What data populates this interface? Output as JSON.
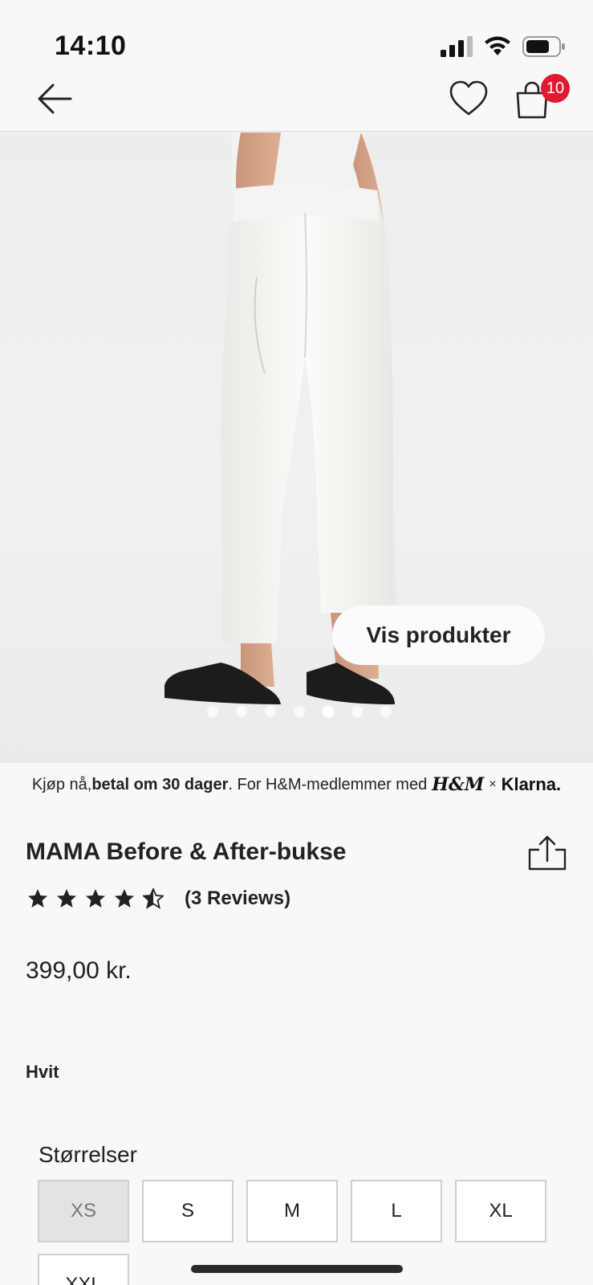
{
  "status_bar": {
    "time": "14:10"
  },
  "nav": {
    "back_icon": "arrow-left-icon",
    "favorite_icon": "heart-icon",
    "bag_icon": "shopping-bag-icon",
    "bag_count": "10"
  },
  "hero": {
    "show_products_label": "Vis produkter",
    "carousel_count": 7,
    "carousel_active": 5
  },
  "klarna": {
    "prefix": "Kjøp nå, ",
    "bold": "betal om 30 dager",
    "middle": ". For H&M-medlemmer med ",
    "hm": "H&M",
    "times": "×",
    "klarna_logo": "Klarna."
  },
  "product": {
    "title": "MAMA Before & After-bukse",
    "rating": 4.5,
    "rating_max": 5,
    "reviews": "(3 Reviews)",
    "price": "399,00 kr.",
    "color": "Hvit",
    "sizes_label": "Størrelser",
    "sizes": [
      {
        "label": "XS",
        "available": false
      },
      {
        "label": "S",
        "available": true
      },
      {
        "label": "M",
        "available": true
      },
      {
        "label": "L",
        "available": true
      },
      {
        "label": "XL",
        "available": true
      },
      {
        "label": "XXL",
        "available": true
      }
    ]
  },
  "colors": {
    "badge": "#e01b2f",
    "accent": "#222222"
  }
}
